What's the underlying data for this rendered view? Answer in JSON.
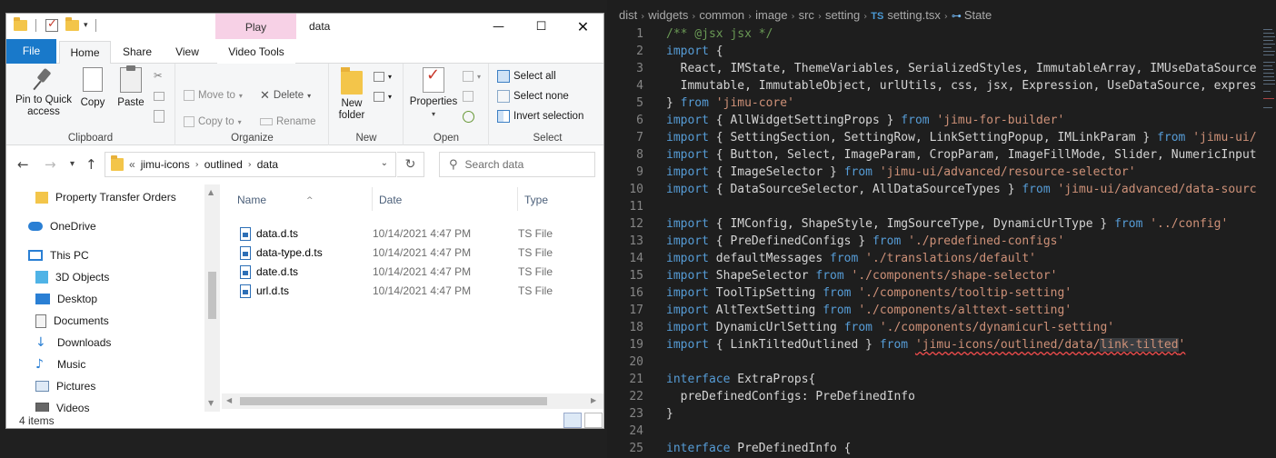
{
  "explorer": {
    "window_title": "data",
    "contextual_tab": "Play",
    "ribbon_tabs": {
      "file": "File",
      "home": "Home",
      "share": "Share",
      "view": "View",
      "video_tools": "Video Tools"
    },
    "clipboard": {
      "label": "Clipboard",
      "pin": "Pin to Quick access",
      "copy": "Copy",
      "paste": "Paste"
    },
    "organize": {
      "label": "Organize",
      "move_to": "Move to",
      "copy_to": "Copy to",
      "delete": "Delete",
      "rename": "Rename"
    },
    "new_group": {
      "label": "New",
      "new_folder": "New folder"
    },
    "open_group": {
      "label": "Open",
      "properties": "Properties"
    },
    "select_group": {
      "label": "Select",
      "select_all": "Select all",
      "select_none": "Select none",
      "invert": "Invert selection"
    },
    "address": {
      "overflow": "«",
      "parts": [
        "jimu-icons",
        "outlined",
        "data"
      ]
    },
    "search_placeholder": "Search data",
    "nav_items": [
      {
        "label": "Property Transfer Orders",
        "icon": "folder-icon"
      },
      {
        "label": "OneDrive",
        "icon": "cloud-icon"
      },
      {
        "label": "This PC",
        "icon": "computer-icon"
      },
      {
        "label": "3D Objects",
        "icon": "cube-icon"
      },
      {
        "label": "Desktop",
        "icon": "desktop-icon"
      },
      {
        "label": "Documents",
        "icon": "documents-icon"
      },
      {
        "label": "Downloads",
        "icon": "download-icon"
      },
      {
        "label": "Music",
        "icon": "music-icon"
      },
      {
        "label": "Pictures",
        "icon": "pictures-icon"
      },
      {
        "label": "Videos",
        "icon": "videos-icon"
      }
    ],
    "columns": {
      "name": "Name",
      "date": "Date",
      "type": "Type"
    },
    "files": [
      {
        "name": "data.d.ts",
        "date": "10/14/2021 4:47 PM",
        "type": "TS File"
      },
      {
        "name": "data-type.d.ts",
        "date": "10/14/2021 4:47 PM",
        "type": "TS File"
      },
      {
        "name": "date.d.ts",
        "date": "10/14/2021 4:47 PM",
        "type": "TS File"
      },
      {
        "name": "url.d.ts",
        "date": "10/14/2021 4:47 PM",
        "type": "TS File"
      }
    ],
    "status": "4 items"
  },
  "editor": {
    "breadcrumb": [
      "dist",
      "widgets",
      "common",
      "image",
      "src",
      "setting"
    ],
    "file_badge": "TS",
    "file_name": "setting.tsx",
    "symbol": "State",
    "lines": [
      {
        "n": "1",
        "segs": [
          [
            "cm",
            "/** @jsx jsx */"
          ]
        ]
      },
      {
        "n": "2",
        "segs": [
          [
            "kw",
            "import"
          ],
          [
            "",
            " {"
          ]
        ]
      },
      {
        "n": "3",
        "segs": [
          [
            "",
            "  React, IMState, ThemeVariables, SerializedStyles, ImmutableArray, IMUseDataSource, "
          ]
        ]
      },
      {
        "n": "4",
        "segs": [
          [
            "",
            "  Immutable, ImmutableObject, urlUtils, css, jsx, Expression, UseDataSource, expressi"
          ]
        ]
      },
      {
        "n": "5",
        "segs": [
          [
            "",
            "} "
          ],
          [
            "kw",
            "from"
          ],
          [
            "",
            " "
          ],
          [
            "str",
            "'jimu-core'"
          ]
        ]
      },
      {
        "n": "6",
        "segs": [
          [
            "kw",
            "import"
          ],
          [
            "",
            " { AllWidgetSettingProps } "
          ],
          [
            "kw",
            "from"
          ],
          [
            "",
            " "
          ],
          [
            "str",
            "'jimu-for-builder'"
          ]
        ]
      },
      {
        "n": "7",
        "segs": [
          [
            "kw",
            "import"
          ],
          [
            "",
            " { SettingSection, SettingRow, LinkSettingPopup, IMLinkParam } "
          ],
          [
            "kw",
            "from"
          ],
          [
            "",
            " "
          ],
          [
            "str",
            "'jimu-ui/ad"
          ]
        ]
      },
      {
        "n": "8",
        "segs": [
          [
            "kw",
            "import"
          ],
          [
            "",
            " { Button, Select, ImageParam, CropParam, ImageFillMode, Slider, NumericInput, "
          ]
        ]
      },
      {
        "n": "9",
        "segs": [
          [
            "kw",
            "import"
          ],
          [
            "",
            " { ImageSelector } "
          ],
          [
            "kw",
            "from"
          ],
          [
            "",
            " "
          ],
          [
            "str",
            "'jimu-ui/advanced/resource-selector'"
          ]
        ]
      },
      {
        "n": "10",
        "segs": [
          [
            "kw",
            "import"
          ],
          [
            "",
            " { DataSourceSelector, AllDataSourceTypes } "
          ],
          [
            "kw",
            "from"
          ],
          [
            "",
            " "
          ],
          [
            "str",
            "'jimu-ui/advanced/data-source-"
          ]
        ]
      },
      {
        "n": "11",
        "segs": []
      },
      {
        "n": "12",
        "segs": [
          [
            "kw",
            "import"
          ],
          [
            "",
            " { IMConfig, ShapeStyle, ImgSourceType, DynamicUrlType } "
          ],
          [
            "kw",
            "from"
          ],
          [
            "",
            " "
          ],
          [
            "str",
            "'../config'"
          ]
        ]
      },
      {
        "n": "13",
        "segs": [
          [
            "kw",
            "import"
          ],
          [
            "",
            " { PreDefinedConfigs } "
          ],
          [
            "kw",
            "from"
          ],
          [
            "",
            " "
          ],
          [
            "str",
            "'./predefined-configs'"
          ]
        ]
      },
      {
        "n": "14",
        "segs": [
          [
            "kw",
            "import"
          ],
          [
            "",
            " defaultMessages "
          ],
          [
            "kw",
            "from"
          ],
          [
            "",
            " "
          ],
          [
            "str",
            "'./translations/default'"
          ]
        ]
      },
      {
        "n": "15",
        "segs": [
          [
            "kw",
            "import"
          ],
          [
            "",
            " ShapeSelector "
          ],
          [
            "kw",
            "from"
          ],
          [
            "",
            " "
          ],
          [
            "str",
            "'./components/shape-selector'"
          ]
        ]
      },
      {
        "n": "16",
        "segs": [
          [
            "kw",
            "import"
          ],
          [
            "",
            " ToolTipSetting "
          ],
          [
            "kw",
            "from"
          ],
          [
            "",
            " "
          ],
          [
            "str",
            "'./components/tooltip-setting'"
          ]
        ]
      },
      {
        "n": "17",
        "segs": [
          [
            "kw",
            "import"
          ],
          [
            "",
            " AltTextSetting "
          ],
          [
            "kw",
            "from"
          ],
          [
            "",
            " "
          ],
          [
            "str",
            "'./components/alttext-setting'"
          ]
        ]
      },
      {
        "n": "18",
        "segs": [
          [
            "kw",
            "import"
          ],
          [
            "",
            " DynamicUrlSetting "
          ],
          [
            "kw",
            "from"
          ],
          [
            "",
            " "
          ],
          [
            "str",
            "'./components/dynamicurl-setting'"
          ]
        ]
      },
      {
        "n": "19",
        "segs": [
          [
            "kw",
            "import"
          ],
          [
            "",
            " { LinkTiltedOutlined } "
          ],
          [
            "kw",
            "from"
          ],
          [
            "",
            " "
          ],
          [
            "str sq",
            "'jimu-icons/outlined/data/"
          ],
          [
            "str sq hl",
            "link-tilted"
          ],
          [
            "str sq",
            "'"
          ]
        ]
      },
      {
        "n": "20",
        "segs": []
      },
      {
        "n": "21",
        "segs": [
          [
            "kw",
            "interface"
          ],
          [
            "",
            " ExtraProps{"
          ]
        ]
      },
      {
        "n": "22",
        "segs": [
          [
            "",
            "  preDefinedConfigs: PreDefinedInfo"
          ]
        ]
      },
      {
        "n": "23",
        "segs": [
          [
            "",
            "}"
          ]
        ]
      },
      {
        "n": "24",
        "segs": []
      },
      {
        "n": "25",
        "segs": [
          [
            "kw",
            "interface"
          ],
          [
            "",
            " PreDefinedInfo {"
          ]
        ]
      }
    ]
  },
  "colors": {
    "file_tab": "#1979ca",
    "contextual_tab": "#f7d1e6",
    "keyword": "#569cd6",
    "string": "#ce9178",
    "comment": "#6a9955"
  }
}
